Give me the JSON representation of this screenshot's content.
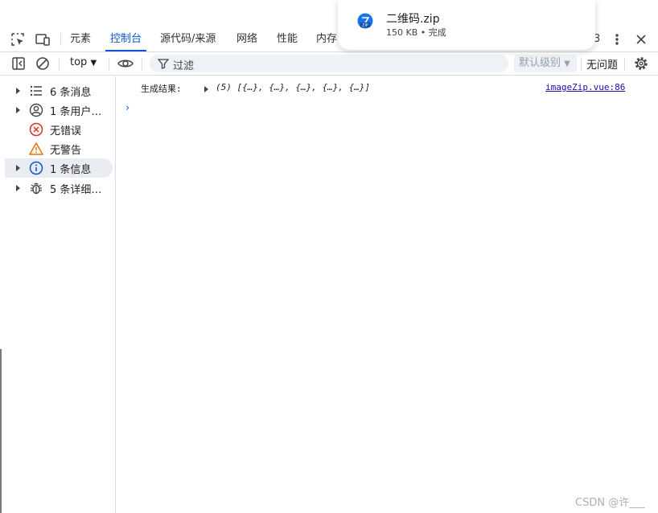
{
  "tabs": {
    "elements": "元素",
    "console": "控制台",
    "sources": "源代码/来源",
    "network": "网络",
    "performance": "性能",
    "memory": "内存",
    "overflow_count": "3"
  },
  "toolbar": {
    "context": "top",
    "filter_placeholder": "过滤",
    "levels": "默认级别",
    "issues": "无问题"
  },
  "sidebar": {
    "items": [
      {
        "label": "6 条消息",
        "icon": "list-icon"
      },
      {
        "label": "1 条用户…",
        "icon": "user-icon"
      },
      {
        "label": "无错误",
        "icon": "error-icon"
      },
      {
        "label": "无警告",
        "icon": "warning-icon"
      },
      {
        "label": "1 条信息",
        "icon": "info-icon"
      },
      {
        "label": "5 条详细…",
        "icon": "bug-icon"
      }
    ]
  },
  "console": {
    "label": "生成结果:",
    "value": "(5) [{…}, {…}, {…}, {…}, {…}]",
    "source": "imageZip.vue:86",
    "prompt": "›"
  },
  "download": {
    "filename": "二维码.zip",
    "meta": "150 KB • 完成",
    "icon": "zip-file-icon"
  },
  "watermark": "CSDN @许___",
  "colors": {
    "accent": "#0b57d0",
    "error": "#d93025",
    "warning": "#e8710a",
    "link": "#1a0dab"
  }
}
